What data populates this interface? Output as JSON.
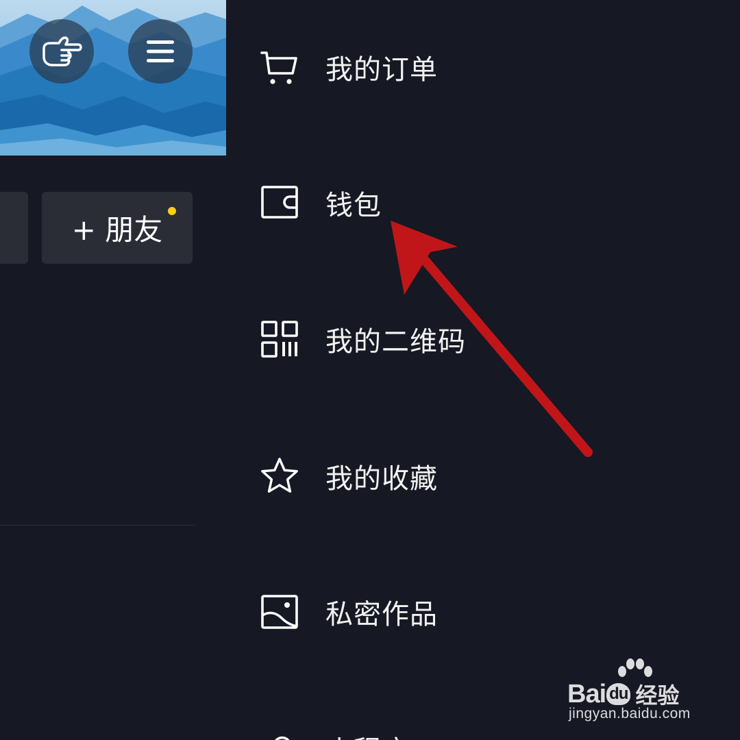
{
  "profile": {
    "add_friend_label": "+ 朋友"
  },
  "menu": {
    "items": [
      {
        "label": "我的订单",
        "icon": "cart-icon"
      },
      {
        "label": "钱包",
        "icon": "wallet-icon"
      },
      {
        "label": "我的二维码",
        "icon": "qr-code-icon"
      },
      {
        "label": "我的收藏",
        "icon": "star-icon"
      },
      {
        "label": "私密作品",
        "icon": "image-icon"
      },
      {
        "label": "小程序",
        "icon": "mini-program-icon"
      }
    ]
  },
  "watermark": {
    "brand_latin_1": "Bai",
    "brand_latin_2": "du",
    "brand_cn": "经验",
    "url": "jingyan.baidu.com"
  },
  "colors": {
    "background": "#161823",
    "panel_gray": "#2a2c36",
    "notify_dot": "#face15",
    "arrow": "#c0161a"
  }
}
